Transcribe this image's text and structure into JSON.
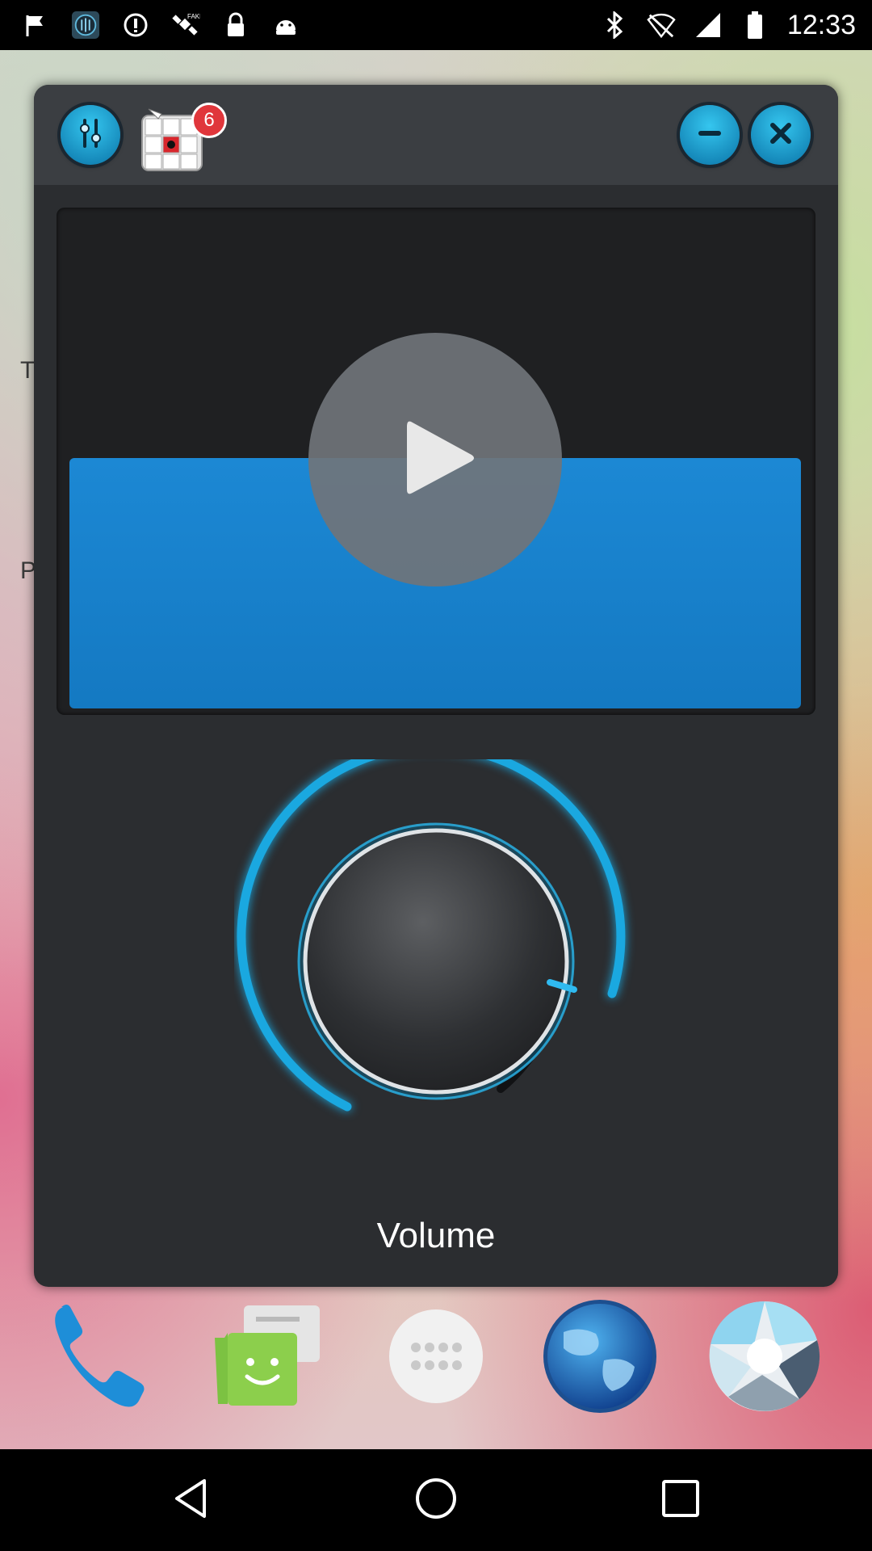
{
  "status_bar": {
    "time": "12:33",
    "icons": [
      "flag-icon",
      "equalizer-app-icon",
      "do-not-disturb-icon",
      "satellite-fake-gps-icon",
      "lock-icon",
      "android-icon",
      "bluetooth-icon",
      "wifi-off-icon",
      "signal-icon",
      "battery-icon"
    ]
  },
  "wallpaper": {
    "letters": [
      "T",
      "P"
    ]
  },
  "widget": {
    "header": {
      "equalizer_icon": "equalizer-icon",
      "game_badge": "6",
      "minimize_icon": "minimize-icon",
      "close_icon": "close-icon"
    },
    "video": {
      "play_icon": "play-icon",
      "accent": "#1c88d4"
    },
    "knob": {
      "label": "Volume",
      "accent": "#1aa8e0"
    }
  },
  "dock": [
    {
      "name": "phone-icon"
    },
    {
      "name": "messaging-icon"
    },
    {
      "name": "app-drawer-icon"
    },
    {
      "name": "browser-globe-icon"
    },
    {
      "name": "camera-shutter-icon"
    }
  ],
  "nav_bar": [
    "back-icon",
    "home-icon",
    "recents-icon"
  ]
}
